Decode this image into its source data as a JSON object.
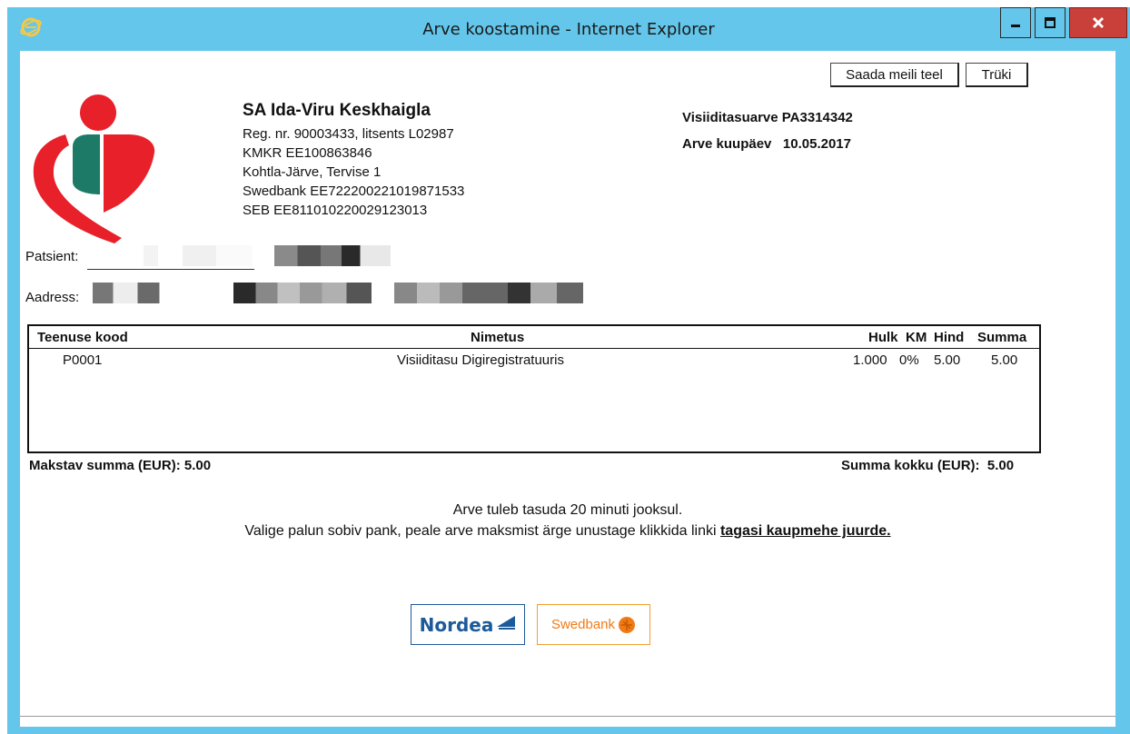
{
  "window": {
    "title": "Arve koostamine - Internet Explorer"
  },
  "toolbar": {
    "email_label": "Saada meili teel",
    "print_label": "Trüki"
  },
  "company": {
    "name": "SA Ida-Viru Keskhaigla",
    "lines": [
      "Reg. nr. 90003433, litsents L02987",
      "KMKR EE100863846",
      "Kohtla-Järve, Tervise 1",
      "Swedbank EE722200221019871533",
      "SEB EE811010220029123013"
    ]
  },
  "invoice": {
    "number_label": "Visiiditasuarve PA3314342",
    "date_label": "Arve kuupäev",
    "date_value": "10.05.2017"
  },
  "patient": {
    "patient_label": "Patsient:",
    "address_label": "Aadress:"
  },
  "table": {
    "headers": {
      "code": "Teenuse kood",
      "name": "Nimetus",
      "qty": "Hulk",
      "vat": "KM",
      "price": "Hind",
      "sum": "Summa"
    },
    "rows": [
      {
        "code": "P0001",
        "name": "Visiiditasu Digiregistratuuris",
        "qty": "1.000",
        "vat": "0%",
        "price": "5.00",
        "sum": "5.00"
      }
    ]
  },
  "totals": {
    "payable_label": "Makstav summa (EUR): 5.00",
    "total_label": "Summa kokku (EUR):",
    "total_value": "5.00"
  },
  "notes": {
    "line1": "Arve tuleb tasuda 20 minuti jooksul.",
    "line2": "Valige palun sobiv pank, peale arve maksmist ärge unustage klikkida linki",
    "link": "tagasi kaupmehe juurde."
  },
  "banks": {
    "nordea": "Nordea",
    "swedbank": "Swedbank"
  },
  "colors": {
    "titlebar": "#63c6ea",
    "close_button": "#c9403a",
    "logo_red": "#e8202a",
    "logo_green": "#1c7a66",
    "nordea_blue": "#1c5a9a",
    "swedbank_orange": "#f07b16"
  }
}
